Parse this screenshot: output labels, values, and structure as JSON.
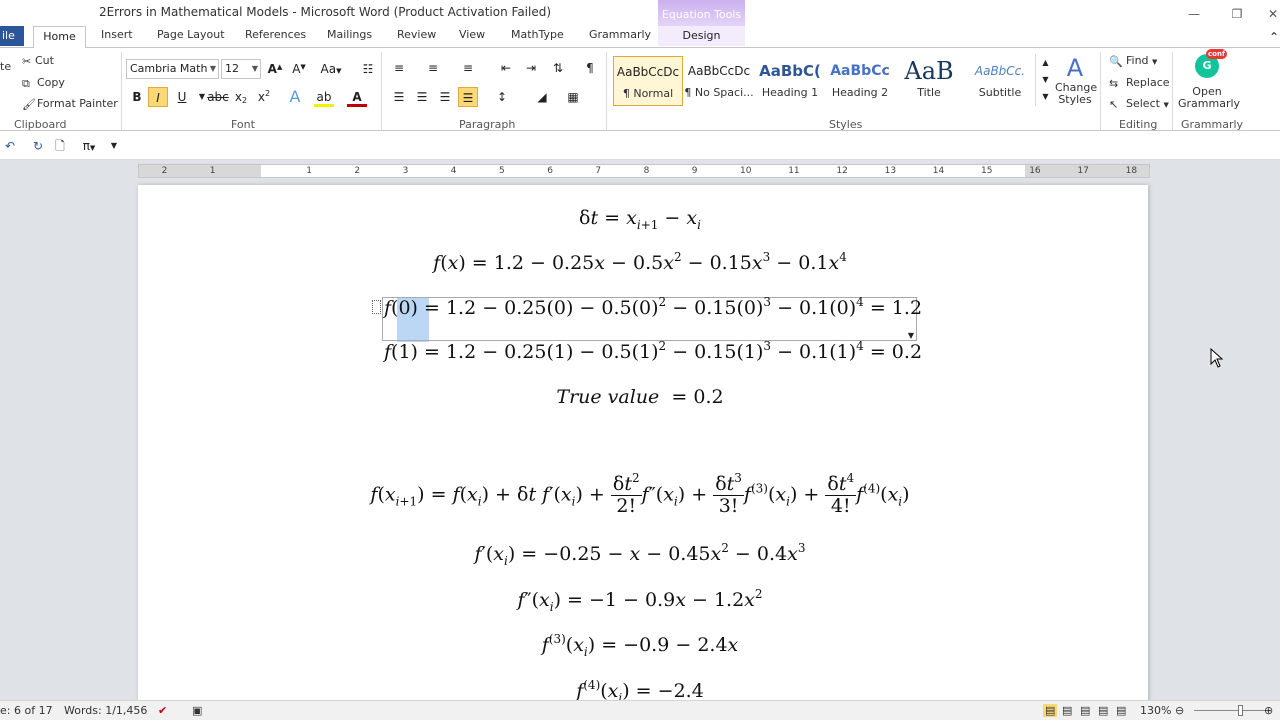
{
  "window": {
    "title": "2Errors in Mathematical Models  -  Microsoft Word (Product Activation Failed)",
    "context_tab_group": "Equation Tools"
  },
  "tabs": [
    {
      "label": "ile"
    },
    {
      "label": "Home"
    },
    {
      "label": "Insert"
    },
    {
      "label": "Page Layout"
    },
    {
      "label": "References"
    },
    {
      "label": "Mailings"
    },
    {
      "label": "Review"
    },
    {
      "label": "View"
    },
    {
      "label": "MathType"
    },
    {
      "label": "Grammarly"
    },
    {
      "label": "Design"
    }
  ],
  "clipboard": {
    "paste": "te",
    "cut": "Cut",
    "copy": "Copy",
    "format_painter": "Format Painter",
    "group": "Clipboard"
  },
  "font": {
    "name": "Cambria Math",
    "size": "12",
    "group": "Font",
    "aa": "Aa"
  },
  "paragraph": {
    "group": "Paragraph"
  },
  "styles": {
    "group": "Styles",
    "items": [
      {
        "preview": "AaBbCcDc",
        "name": "¶ Normal"
      },
      {
        "preview": "AaBbCcDc",
        "name": "¶ No Spaci..."
      },
      {
        "preview": "AaBbC(",
        "name": "Heading 1"
      },
      {
        "preview": "AaBbCc",
        "name": "Heading 2"
      },
      {
        "preview": "AaB",
        "name": "Title"
      },
      {
        "preview": "AaBbCc.",
        "name": "Subtitle"
      }
    ],
    "change_styles": "Change Styles"
  },
  "editing": {
    "group": "Editing",
    "find": "Find",
    "replace": "Replace",
    "select": "Select"
  },
  "grammarly": {
    "group": "Grammarly",
    "open": "Open Grammarly",
    "badge": "conf"
  },
  "ruler": {
    "numbers": [
      "2",
      "1",
      "1",
      "2",
      "3",
      "4",
      "5",
      "6",
      "7",
      "8",
      "9",
      "10",
      "11",
      "12",
      "13",
      "14",
      "15",
      "16",
      "17",
      "18"
    ]
  },
  "status": {
    "page": "e: 6 of 17",
    "words": "Words: 1/1,456",
    "zoom": "130%"
  }
}
